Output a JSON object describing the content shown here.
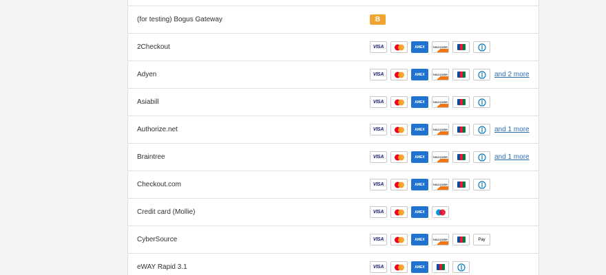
{
  "gateways": [
    {
      "name": "(for testing) Bogus Gateway",
      "cards": [],
      "badge": "B",
      "more": ""
    },
    {
      "name": "2Checkout",
      "cards": [
        "visa",
        "mastercard",
        "amex",
        "discover",
        "jcb",
        "diners"
      ],
      "more": ""
    },
    {
      "name": "Adyen",
      "cards": [
        "visa",
        "mastercard",
        "amex",
        "discover",
        "jcb",
        "diners"
      ],
      "more": "and 2 more"
    },
    {
      "name": "Asiabill",
      "cards": [
        "visa",
        "mastercard",
        "amex",
        "discover",
        "jcb",
        "diners"
      ],
      "more": ""
    },
    {
      "name": "Authorize.net",
      "cards": [
        "visa",
        "mastercard",
        "amex",
        "discover",
        "jcb",
        "diners"
      ],
      "more": "and 1 more"
    },
    {
      "name": "Braintree",
      "cards": [
        "visa",
        "mastercard",
        "amex",
        "discover",
        "jcb",
        "diners"
      ],
      "more": "and 1 more"
    },
    {
      "name": "Checkout.com",
      "cards": [
        "visa",
        "mastercard",
        "amex",
        "discover",
        "jcb",
        "diners"
      ],
      "more": ""
    },
    {
      "name": "Credit card (Mollie)",
      "cards": [
        "visa",
        "mastercard",
        "amex",
        "maestro"
      ],
      "more": ""
    },
    {
      "name": "CyberSource",
      "cards": [
        "visa",
        "mastercard",
        "amex",
        "discover",
        "jcb",
        "applepay"
      ],
      "more": ""
    },
    {
      "name": "eWAY Rapid 3.1",
      "cards": [
        "visa",
        "mastercard",
        "amex",
        "jcb",
        "diners"
      ],
      "more": ""
    }
  ],
  "card_labels": {
    "visa": "VISA",
    "amex": "AMEX",
    "discover": "DISCOVER",
    "applepay": " Pay"
  },
  "colors": {
    "bogus_badge": "#f0a533",
    "link": "#2b6cb0",
    "amex": "#1f72cd",
    "mastercard_red": "#eb001b",
    "mastercard_orange": "#f79e1b",
    "maestro_blue": "#0099df",
    "visa_navy": "#1a1f71"
  }
}
